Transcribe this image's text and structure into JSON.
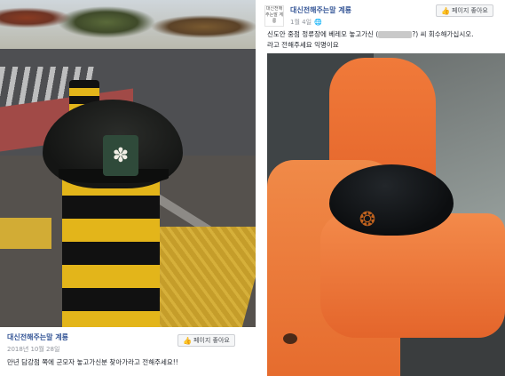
{
  "left_post": {
    "page_name": "대신전해주는말 계룡",
    "date": "2018년 10월 28일",
    "like_button_label": "페이지 좋아요",
    "caption": "만년 담강점 쪽에 군모자 놓고가신분 찾아가라고 전해주세요!!"
  },
  "right_post": {
    "avatar_text": "대신전해주는말 계룡",
    "page_name": "대신전해주는말 계룡",
    "date": "1월 4일",
    "like_button_label": "페이지 좋아요",
    "caption_part1": "신도안 중점 정류장에 베레모 놓고가신",
    "caption_part2": "?) 씨 회수해가십시오.",
    "caption_line2": "라고 전해주세요  익명이요"
  },
  "icons": {
    "like": "thumbs-up-icon",
    "globe": "globe-icon"
  },
  "colors": {
    "link": "#385898",
    "muted": "#90949c",
    "bollard_yellow": "#e3b51a",
    "seat_orange": "#e66c2e"
  }
}
